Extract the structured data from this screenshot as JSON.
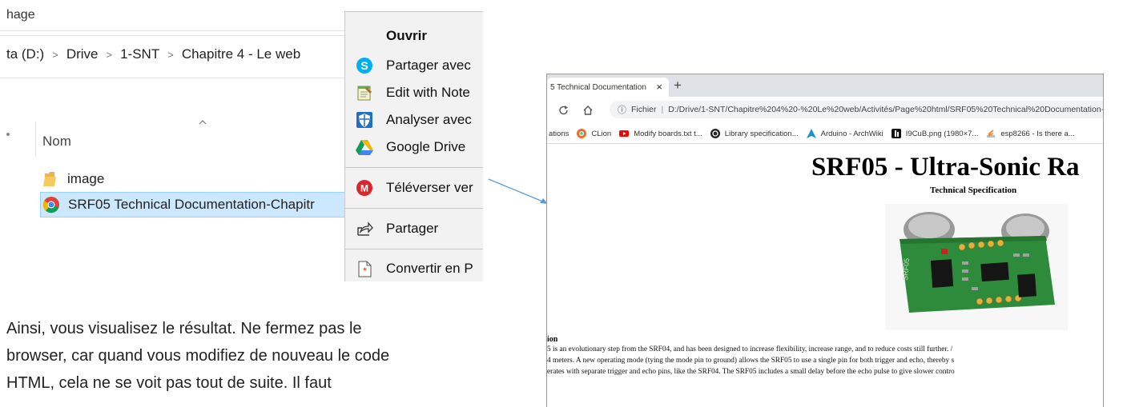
{
  "explorer": {
    "title_fragment": "hage",
    "breadcrumb": [
      "ta (D:)",
      "Drive",
      "1-SNT",
      "Chapitre 4 - Le web"
    ],
    "column_header": "Nom",
    "files": [
      {
        "name": "image",
        "icon": "folder-icon",
        "selected": false
      },
      {
        "name": "SRF05 Technical Documentation-Chapitr",
        "icon": "chrome-icon",
        "selected": true
      }
    ]
  },
  "context_menu": {
    "items": [
      {
        "label": "Ouvrir",
        "icon": "",
        "bold": true
      },
      {
        "label": "Partager avec",
        "icon": "skype-icon"
      },
      {
        "label": "Edit with Note",
        "icon": "notepad-icon"
      },
      {
        "label": "Analyser avec",
        "icon": "shield-icon"
      },
      {
        "label": "Google Drive",
        "icon": "google-drive-icon"
      },
      {
        "label": "Téléverser ver",
        "icon": "mega-icon"
      },
      {
        "label": "Partager",
        "icon": "share-icon"
      },
      {
        "label": "Convertir en P",
        "icon": "pdf-convert-icon"
      }
    ]
  },
  "body_text": [
    "Ainsi, vous visualisez le résultat. Ne fermez pas le",
    "browser, car quand vous modifiez de nouveau le code",
    "HTML, cela ne se voit pas tout de suite. Il faut"
  ],
  "browser": {
    "tab_title": "5 Technical Documentation",
    "tab_close": "×",
    "new_tab": "+",
    "url_scheme_label": "Fichier",
    "url": "D:/Drive/1-SNT/Chapitre%204%20-%20Le%20web/Activités/Page%20html/SRF05%20Technical%20Documentation-",
    "bookmarks": [
      {
        "label": "ations",
        "icon": ""
      },
      {
        "label": "CLion",
        "icon": "clion-icon"
      },
      {
        "label": "Modify boards.txt t...",
        "icon": "youtube-icon"
      },
      {
        "label": "Library specification...",
        "icon": "arduino-icon"
      },
      {
        "label": "Arduino - ArchWiki",
        "icon": "archlinux-icon"
      },
      {
        "label": "I9CuB.png (1980×7...",
        "icon": "image-icon"
      },
      {
        "label": "esp8266 - Is there a...",
        "icon": "stackexchange-icon"
      }
    ],
    "page": {
      "heading": "SRF05 - Ultra-Sonic Ra",
      "subheading": "Technical Specification",
      "section_fragment": "ion",
      "paragraph_lines": [
        "5 is an evolutionary step from the SRF04, and has been designed to increase flexibility, increase range, and to reduce costs still further. /",
        "4 meters. A new operating mode (tying the mode pin to ground) allows the SRF05 to use a single pin for both trigger and echo, thereby s",
        "erates with separate trigger and echo pins, like the SRF04. The SRF05 includes a small delay before the echo pulse to give slower contro"
      ],
      "image_label": "SRF05"
    }
  },
  "colors": {
    "selection": "#cce8ff",
    "menu_bg": "#f2f2f2",
    "arrow": "#5b9bd5",
    "pcb_green": "#2e8b3c"
  }
}
